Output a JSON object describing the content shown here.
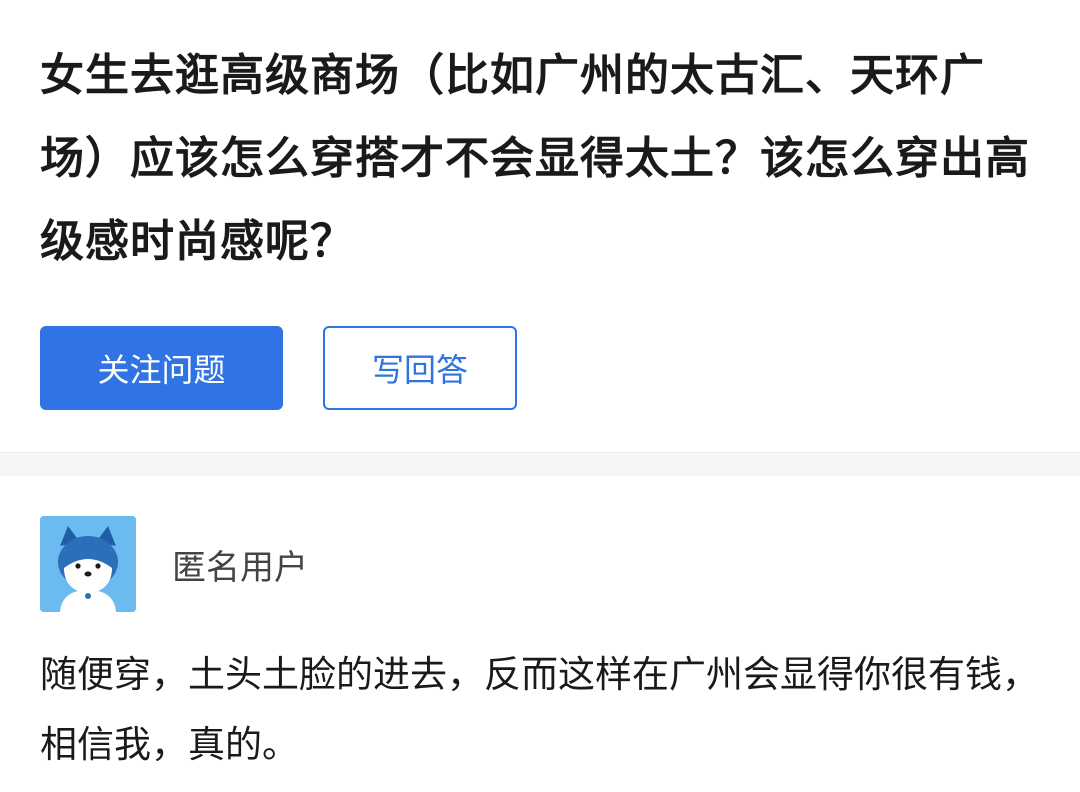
{
  "question": {
    "title": "女生去逛高级商场（比如广州的太古汇、天环广场）应该怎么穿搭才不会显得太土？该怎么穿出高级感时尚感呢？",
    "follow_label": "关注问题",
    "answer_label": "写回答"
  },
  "answer": {
    "avatar_icon": "anonymous-husky-avatar",
    "author": "匿名用户",
    "content": "随便穿，土头土脸的进去，反而这样在广州会显得你很有钱，相信我，真的。"
  },
  "colors": {
    "accent": "#2f73e5",
    "avatar_bg": "#69b8ef"
  }
}
